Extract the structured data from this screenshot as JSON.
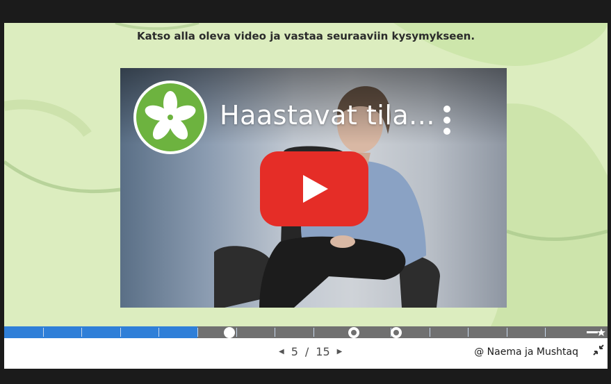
{
  "slide": {
    "prompt": "Katso alla oleva video ja vastaa seuraaviin kysymykseen."
  },
  "video": {
    "title": "Haastavat tila...",
    "channel_logo_icon": "flower-logo-icon",
    "menu_icon": "kebab-menu-icon",
    "play_icon": "youtube-play-icon"
  },
  "progress": {
    "current": 5,
    "total": 15
  },
  "pager": {
    "current": "5",
    "separator": "/",
    "total": "15"
  },
  "footer": {
    "credit": "@ Naema ja Mushtaq"
  },
  "colors": {
    "slide_bg": "#dcedbf",
    "progress_fill": "#2f7fd8",
    "progress_track": "#707070",
    "play_red": "#e52d27",
    "logo_green": "#6db33f"
  }
}
